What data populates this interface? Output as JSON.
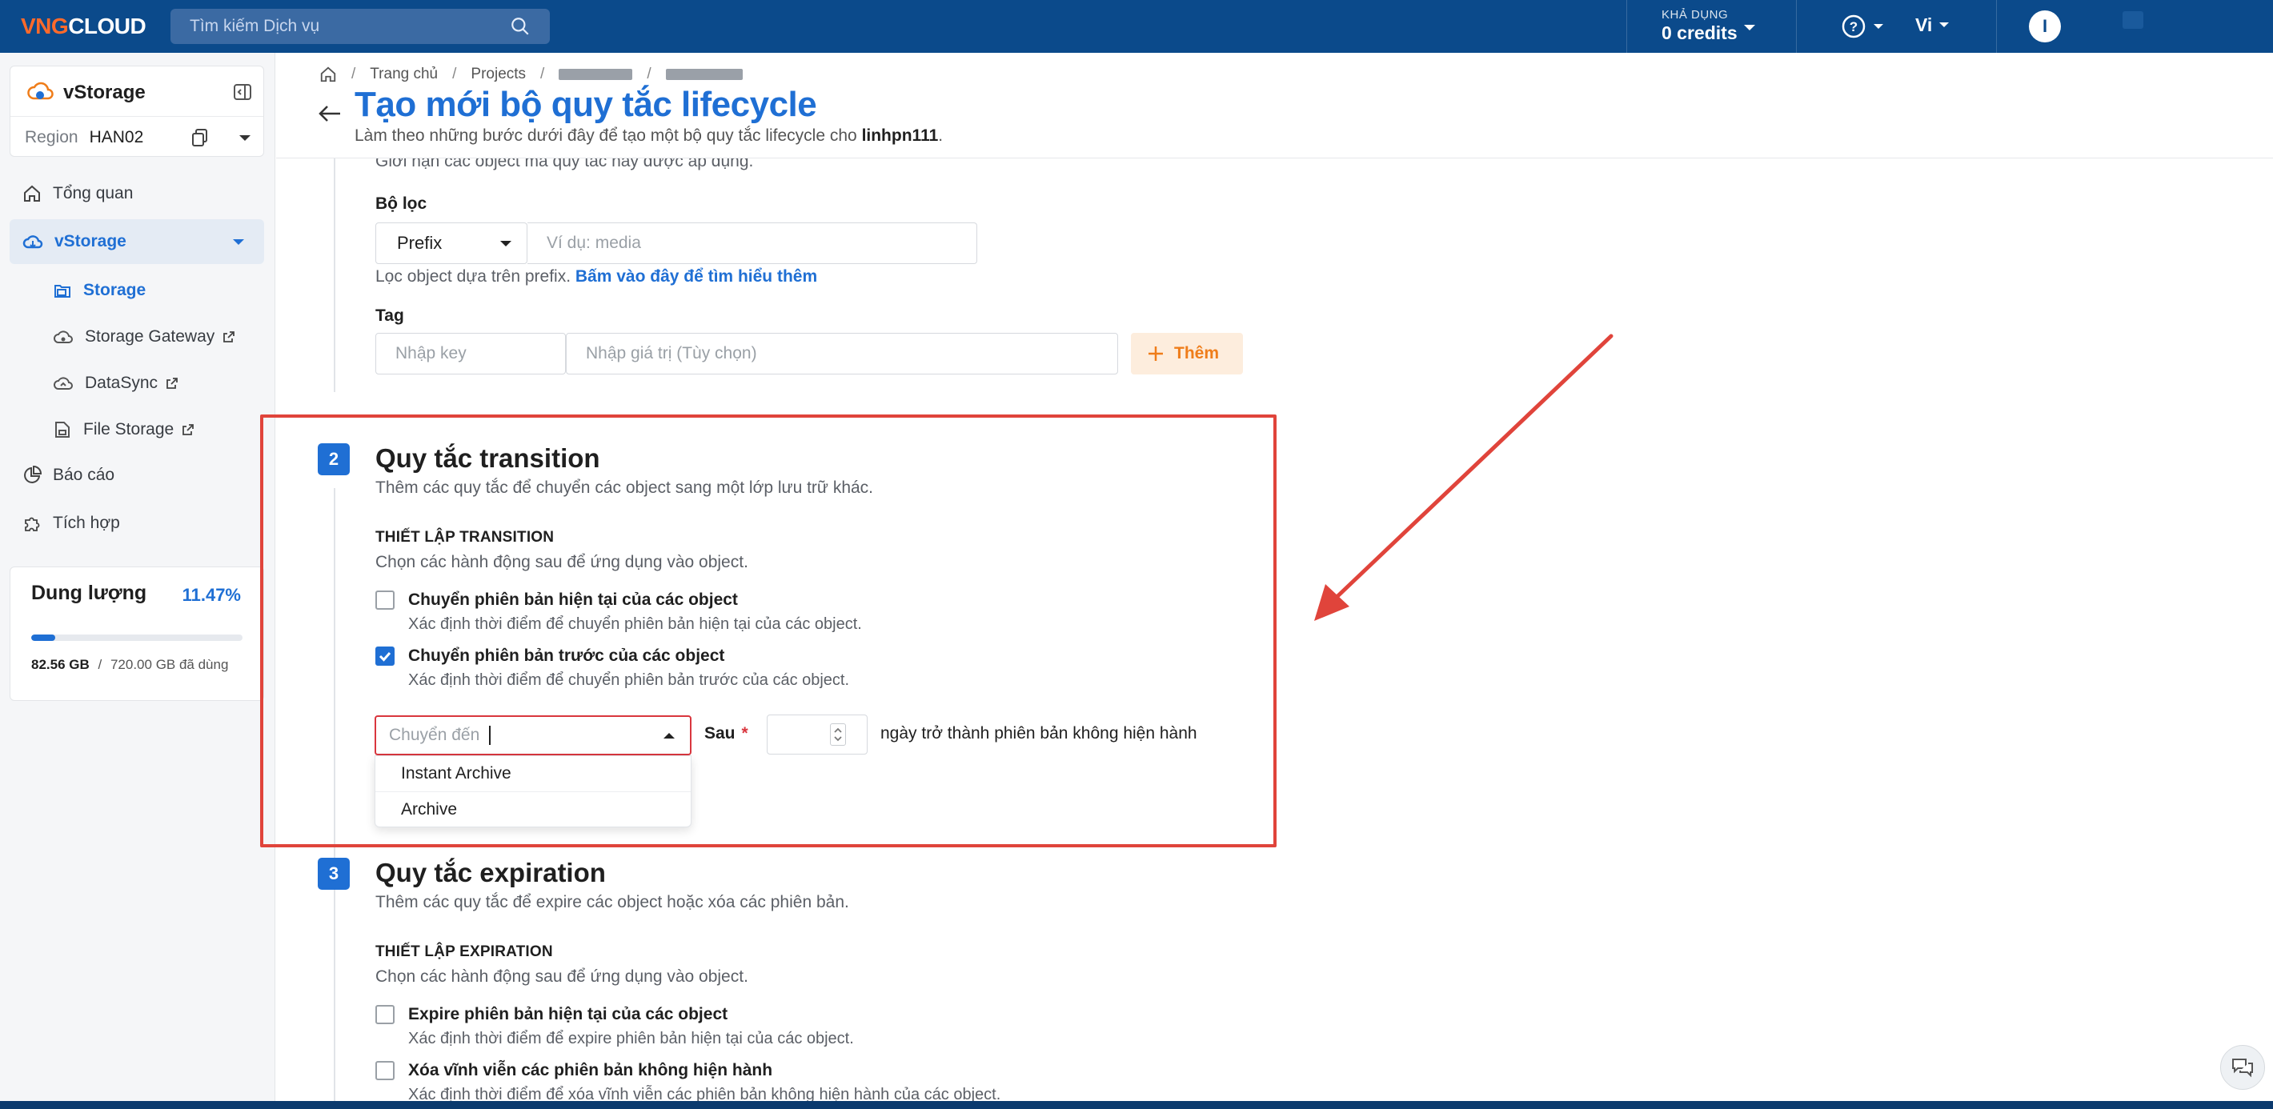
{
  "topbar": {
    "logo_left": "VNG",
    "logo_right": "CLOUD",
    "search_placeholder": "Tìm kiếm Dịch vụ",
    "credits_label": "KHẢ DỤNG",
    "credits_value": "0 credits",
    "language": "Vi",
    "avatar_initial": "I"
  },
  "sidebar": {
    "service_name": "vStorage",
    "region_label": "Region",
    "region_value": "HAN02",
    "nav": {
      "overview": "Tổng quan",
      "vstorage": "vStorage",
      "storage": "Storage",
      "storage_gateway": "Storage Gateway",
      "datasync": "DataSync",
      "file_storage": "File Storage",
      "reports": "Báo cáo",
      "integration": "Tích hợp"
    },
    "usage": {
      "title": "Dung lượng",
      "percent": "11.47%",
      "percent_value": 11.47,
      "used": "82.56 GB",
      "separator": "/",
      "total": "720.00 GB đã dùng"
    }
  },
  "header": {
    "breadcrumb": {
      "home": "Trang chủ",
      "sep": "/",
      "projects": "Projects"
    },
    "title": "Tạo mới bộ quy tắc lifecycle",
    "subtitle_prefix": "Làm theo những bước dưới đây để tạo một bộ quy tắc lifecycle cho ",
    "subtitle_bucket": "linhpn111",
    "subtitle_suffix": "."
  },
  "filter_section": {
    "scope_desc": "Giới hạn các object mà quy tắc này được áp dụng.",
    "filter_label": "Bộ lọc",
    "filter_type": "Prefix",
    "prefix_placeholder": "Ví dụ: media",
    "prefix_help": "Lọc object dựa trên prefix.",
    "prefix_help_link": "Bấm vào đây để tìm hiểu thêm",
    "tag_label": "Tag",
    "tag_key_placeholder": "Nhập key",
    "tag_value_placeholder": "Nhập giá trị (Tùy chọn)",
    "add_button": "Thêm"
  },
  "transition_section": {
    "step": "2",
    "title": "Quy tắc transition",
    "desc": "Thêm các quy tắc để chuyển các object sang một lớp lưu trữ khác.",
    "setup_title": "THIẾT LẬP TRANSITION",
    "setup_desc": "Chọn các hành động sau để ứng dụng vào object.",
    "option1_title": "Chuyển phiên bản hiện tại của các object",
    "option1_desc": "Xác định thời điểm để chuyển phiên bản hiện tại của các object.",
    "option1_checked": false,
    "option2_title": "Chuyển phiên bản trước của các object",
    "option2_desc": "Xác định thời điểm để chuyển phiên bản trước của các object.",
    "option2_checked": true,
    "move_to_placeholder": "Chuyển đến",
    "move_to_options": [
      "Instant Archive",
      "Archive"
    ],
    "after_label": "Sau",
    "after_required": "*",
    "after_text": "ngày trở thành phiên bản không hiện hành"
  },
  "expiration_section": {
    "step": "3",
    "title": "Quy tắc expiration",
    "desc": "Thêm các quy tắc để expire các object hoặc xóa các phiên bản.",
    "setup_title": "THIẾT LẬP EXPIRATION",
    "setup_desc": "Chọn các hành động sau để ứng dụng vào object.",
    "option1_title": "Expire phiên bản hiện tại của các object",
    "option1_desc": "Xác định thời điểm để expire phiên bản hiện tại của các object.",
    "option2_title": "Xóa vĩnh viễn các phiên bản không hiện hành",
    "option2_desc": "Xác định thời điểm để xóa vĩnh viễn các phiên bản không hiện hành của các object."
  },
  "colors": {
    "topbar": "#0b4a8b",
    "accent": "#1f6fd4",
    "highlight": "#e0443b",
    "add_button_text": "#ef7d1a"
  }
}
